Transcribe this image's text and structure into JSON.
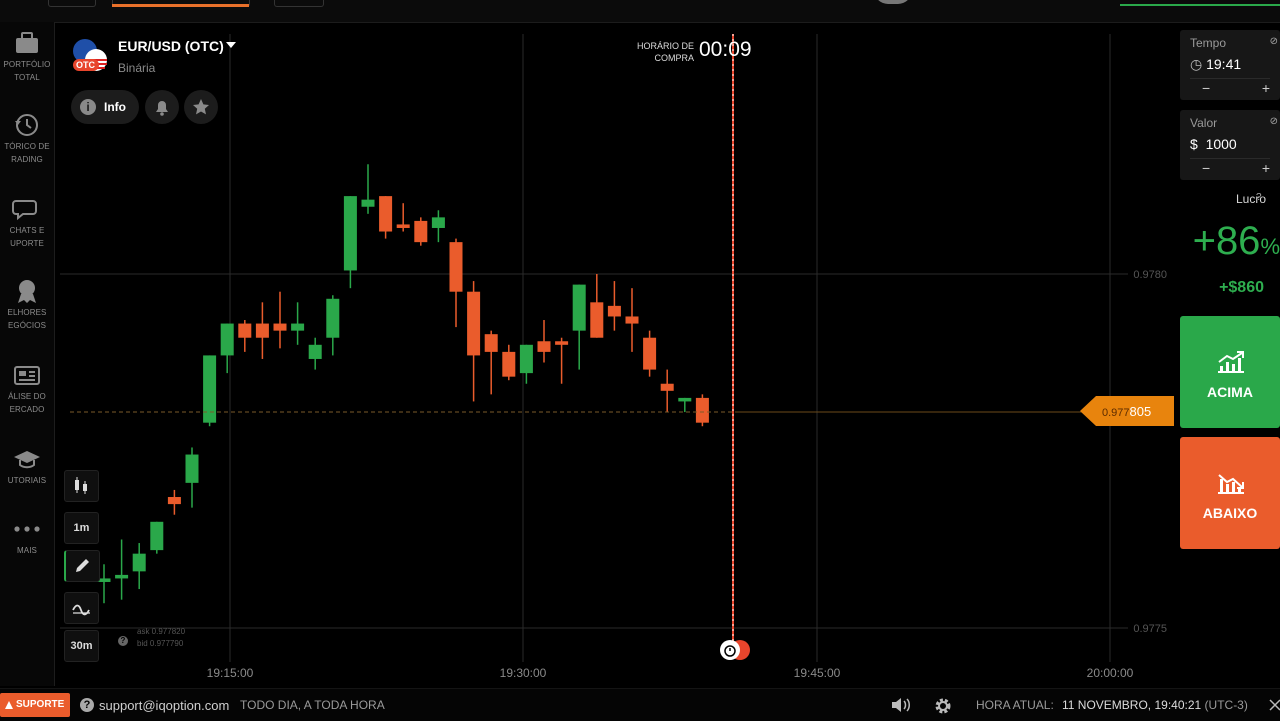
{
  "colors": {
    "up": "#2aa84a",
    "down": "#ea5c2c",
    "accent": "#e8840d",
    "background": "#000000"
  },
  "sidebar": {
    "items": [
      {
        "icon": "briefcase-icon",
        "label": "PORTFÓLIO\nTOTAL"
      },
      {
        "icon": "history-icon",
        "label": "TÓRICO DE\nRADING"
      },
      {
        "icon": "chat-icon",
        "label": "CHATS E\nUPORTE"
      },
      {
        "icon": "award-icon",
        "label": "ELHORES\nEGÓCIOS"
      },
      {
        "icon": "news-icon",
        "label": "ÁLISE DO\nERCADO"
      },
      {
        "icon": "graduation-cap-icon",
        "label": "UTORIAIS"
      },
      {
        "icon": "more-icon",
        "label": "MAIS"
      }
    ]
  },
  "asset": {
    "name": "EUR/USD (OTC)",
    "type": "Binária",
    "badge": "OTC"
  },
  "actions": {
    "info_label": "Info"
  },
  "purchase": {
    "label": "HORÁRIO DE COMPRA",
    "countdown": "00:09"
  },
  "tools": {
    "timeframe": "1m",
    "period": "30m"
  },
  "bid_ask": {
    "ask": "ask 0.977820",
    "bid": "bid 0.977790"
  },
  "price_tag": {
    "prefix": "0.977",
    "suffix": "805"
  },
  "trade": {
    "time": {
      "label": "Tempo",
      "value": "19:41"
    },
    "amount": {
      "label": "Valor",
      "currency": "$",
      "value": "1000"
    },
    "profit": {
      "label": "Lucro",
      "percent": "+86",
      "percent_sign": "%",
      "amount": "+$860"
    },
    "call_label": "ACIMA",
    "put_label": "ABAIXO"
  },
  "footer": {
    "support_label": "SUPORTE",
    "email": "support@iqoption.com",
    "hours": "TODO DIA, A TODA HORA",
    "time_label": "HORA ATUAL:",
    "time_value": "11 NOVEMBRO, 19:40:21",
    "time_zone": "(UTC-3)"
  },
  "chart_data": {
    "type": "candlestick",
    "x_ticks": [
      "19:15:00",
      "19:30:00",
      "19:45:00",
      "20:00:00"
    ],
    "y_ticks": [
      "0.9780",
      "0.9775"
    ],
    "ylim": [
      0.97745,
      0.97865
    ],
    "current_price": 0.977805,
    "candles": [
      {
        "o": 0.977565,
        "h": 0.97759,
        "l": 0.977535,
        "c": 0.97757
      },
      {
        "o": 0.97757,
        "h": 0.977625,
        "l": 0.97754,
        "c": 0.977575
      },
      {
        "o": 0.97758,
        "h": 0.97762,
        "l": 0.977555,
        "c": 0.977605
      },
      {
        "o": 0.97761,
        "h": 0.97764,
        "l": 0.977605,
        "c": 0.97765
      },
      {
        "o": 0.977685,
        "h": 0.977695,
        "l": 0.97766,
        "c": 0.977675
      },
      {
        "o": 0.977705,
        "h": 0.977755,
        "l": 0.97767,
        "c": 0.977745
      },
      {
        "o": 0.97779,
        "h": 0.97782,
        "l": 0.977785,
        "c": 0.977885
      },
      {
        "o": 0.977885,
        "h": 0.977895,
        "l": 0.97786,
        "c": 0.97793
      },
      {
        "o": 0.97793,
        "h": 0.977935,
        "l": 0.97789,
        "c": 0.97791
      },
      {
        "o": 0.97793,
        "h": 0.97796,
        "l": 0.97788,
        "c": 0.97791
      },
      {
        "o": 0.97793,
        "h": 0.977975,
        "l": 0.977895,
        "c": 0.97792
      },
      {
        "o": 0.97792,
        "h": 0.97796,
        "l": 0.9779,
        "c": 0.97793
      },
      {
        "o": 0.97788,
        "h": 0.97791,
        "l": 0.977865,
        "c": 0.9779
      },
      {
        "o": 0.97791,
        "h": 0.97797,
        "l": 0.977885,
        "c": 0.977965
      },
      {
        "o": 0.978005,
        "h": 0.97805,
        "l": 0.97798,
        "c": 0.97811
      },
      {
        "o": 0.978095,
        "h": 0.978155,
        "l": 0.978085,
        "c": 0.978105
      },
      {
        "o": 0.97811,
        "h": 0.978105,
        "l": 0.97805,
        "c": 0.97806
      },
      {
        "o": 0.97807,
        "h": 0.9781,
        "l": 0.97806,
        "c": 0.978065
      },
      {
        "o": 0.978075,
        "h": 0.97808,
        "l": 0.97804,
        "c": 0.978045
      },
      {
        "o": 0.978065,
        "h": 0.97809,
        "l": 0.978045,
        "c": 0.97808
      },
      {
        "o": 0.978045,
        "h": 0.97805,
        "l": 0.977925,
        "c": 0.977975
      },
      {
        "o": 0.977975,
        "h": 0.97799,
        "l": 0.97782,
        "c": 0.977885
      },
      {
        "o": 0.977915,
        "h": 0.97792,
        "l": 0.97783,
        "c": 0.97789
      },
      {
        "o": 0.97789,
        "h": 0.9779,
        "l": 0.97785,
        "c": 0.977855
      },
      {
        "o": 0.97786,
        "h": 0.977895,
        "l": 0.977845,
        "c": 0.9779
      },
      {
        "o": 0.977905,
        "h": 0.977935,
        "l": 0.977875,
        "c": 0.97789
      },
      {
        "o": 0.977905,
        "h": 0.97791,
        "l": 0.977845,
        "c": 0.9779
      },
      {
        "o": 0.97792,
        "h": 0.97795,
        "l": 0.977865,
        "c": 0.977985
      },
      {
        "o": 0.97796,
        "h": 0.978,
        "l": 0.97793,
        "c": 0.97791
      },
      {
        "o": 0.977955,
        "h": 0.97799,
        "l": 0.97792,
        "c": 0.97794
      },
      {
        "o": 0.97794,
        "h": 0.97798,
        "l": 0.97789,
        "c": 0.97793
      },
      {
        "o": 0.97791,
        "h": 0.97792,
        "l": 0.977855,
        "c": 0.977865
      },
      {
        "o": 0.977845,
        "h": 0.977865,
        "l": 0.977805,
        "c": 0.977835
      },
      {
        "o": 0.97782,
        "h": 0.977825,
        "l": 0.977805,
        "c": 0.977825
      },
      {
        "o": 0.977825,
        "h": 0.97783,
        "l": 0.977785,
        "c": 0.97779
      }
    ]
  }
}
